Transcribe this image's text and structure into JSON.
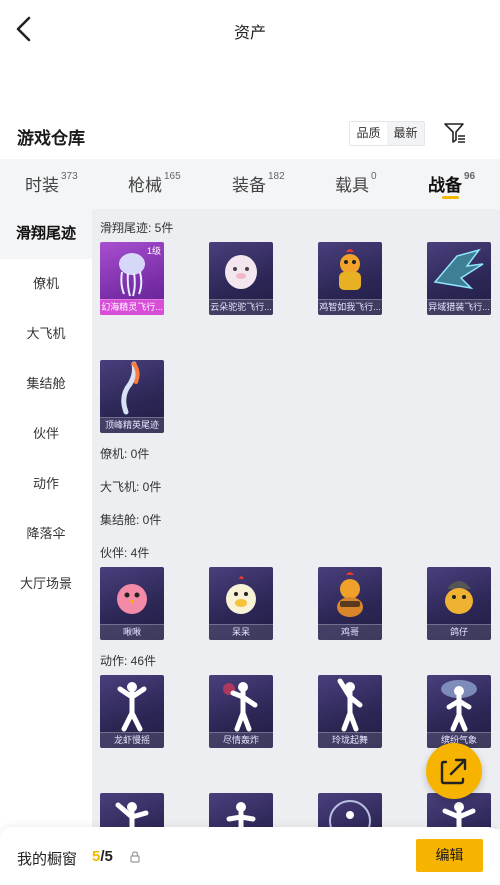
{
  "header": {
    "title": "资产"
  },
  "warehouse": {
    "title": "游戏仓库",
    "sort_options": [
      "品质",
      "最新"
    ],
    "sort_selected": "品质"
  },
  "tabs": [
    {
      "label": "时装",
      "count": "373"
    },
    {
      "label": "枪械",
      "count": "165"
    },
    {
      "label": "装备",
      "count": "182"
    },
    {
      "label": "载具",
      "count": "0"
    },
    {
      "label": "战备",
      "count": "96",
      "active": true
    }
  ],
  "sidebar": {
    "items": [
      "滑翔尾迹",
      "僚机",
      "大飞机",
      "集结舱",
      "伙伴",
      "动作",
      "降落伞",
      "大厅场景"
    ],
    "active": "滑翔尾迹"
  },
  "sections": {
    "trail": {
      "header": "滑翔尾迹: 5件",
      "items": [
        {
          "name": "幻海精灵飞行...",
          "level": "1级",
          "icon": "jellyfish-icon"
        },
        {
          "name": "云朵驼驼飞行...",
          "icon": "fluffy-sheep-icon"
        },
        {
          "name": "鸡智如我飞行...",
          "icon": "chicken-robot-icon"
        },
        {
          "name": "异域猎装飞行...",
          "icon": "dragon-wing-icon"
        },
        {
          "name": "顶峰精英尾迹",
          "icon": "flame-trail-icon"
        }
      ]
    },
    "wingman": {
      "header": "僚机: 0件"
    },
    "plane": {
      "header": "大飞机: 0件"
    },
    "pod": {
      "header": "集结舱: 0件"
    },
    "partner": {
      "header": "伙伴: 4件",
      "items": [
        {
          "name": "啾啾",
          "icon": "pink-chick-icon"
        },
        {
          "name": "呆呆",
          "icon": "yellow-chick-icon"
        },
        {
          "name": "鸡哥",
          "icon": "rooster-guitar-icon"
        },
        {
          "name": "鸽仔",
          "icon": "helmet-pigeon-icon"
        }
      ]
    },
    "action": {
      "header": "动作: 46件",
      "items": [
        {
          "name": "龙虾慢摇",
          "icon": "dance-pose-icon"
        },
        {
          "name": "尽情轰炸",
          "icon": "dance-pose-icon"
        },
        {
          "name": "玲珑起舞",
          "icon": "dance-pose-icon"
        },
        {
          "name": "缤纷气象",
          "icon": "dance-pose-icon"
        }
      ]
    }
  },
  "showcase": {
    "label": "我的橱窗",
    "current": "5",
    "total": "/5"
  },
  "edit_button": "编辑",
  "colors": {
    "accent": "#f6b300",
    "card_bg": "#2b2654",
    "card_pink": "#a84fd0"
  }
}
